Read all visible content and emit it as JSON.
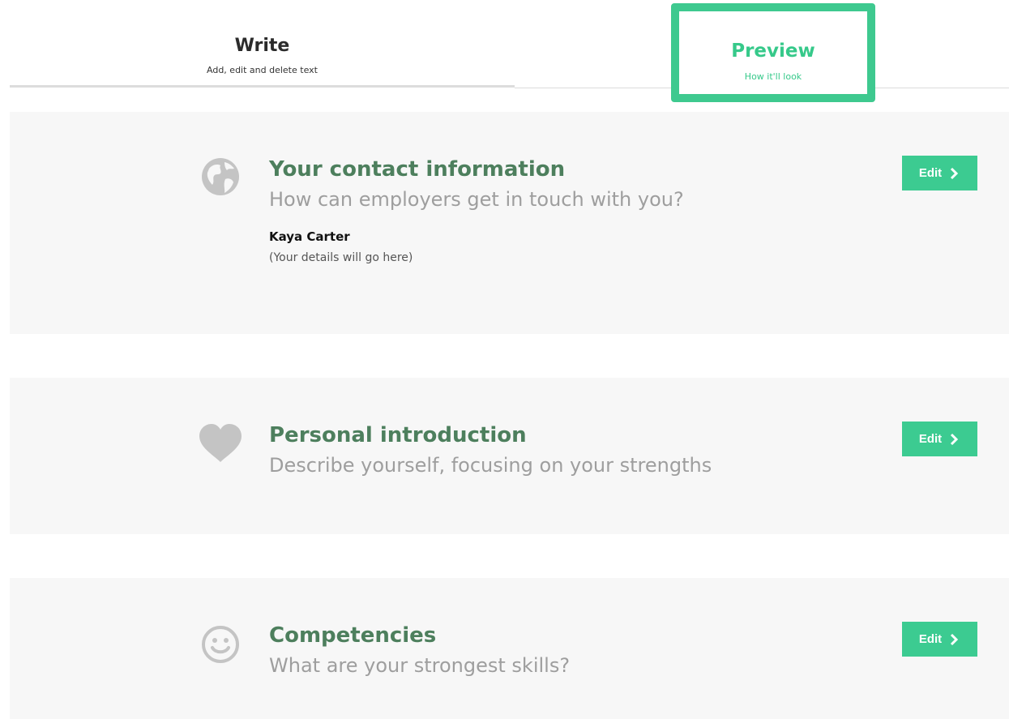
{
  "tabs": {
    "write": {
      "title": "Write",
      "subtitle": "Add, edit and delete text"
    },
    "preview": {
      "title": "Preview",
      "subtitle": "How it'll look",
      "active": true
    }
  },
  "colors": {
    "accent": "#3ccb91",
    "heading": "#4d7f5d",
    "muted": "#9e9e9e",
    "card_bg": "#f7f7f7",
    "icon_gray": "#c4c4c4"
  },
  "sections": [
    {
      "icon": "globe-icon",
      "title": "Your contact information",
      "subtitle": "How can employers get in touch with you?",
      "name": "Kaya Carter",
      "note": "(Your details will go here)",
      "edit_label": "Edit"
    },
    {
      "icon": "heart-icon",
      "title": "Personal introduction",
      "subtitle": "Describe yourself, focusing on your strengths",
      "edit_label": "Edit"
    },
    {
      "icon": "smiley-icon",
      "title": "Competencies",
      "subtitle": "What are your strongest skills?",
      "edit_label": "Edit"
    }
  ]
}
